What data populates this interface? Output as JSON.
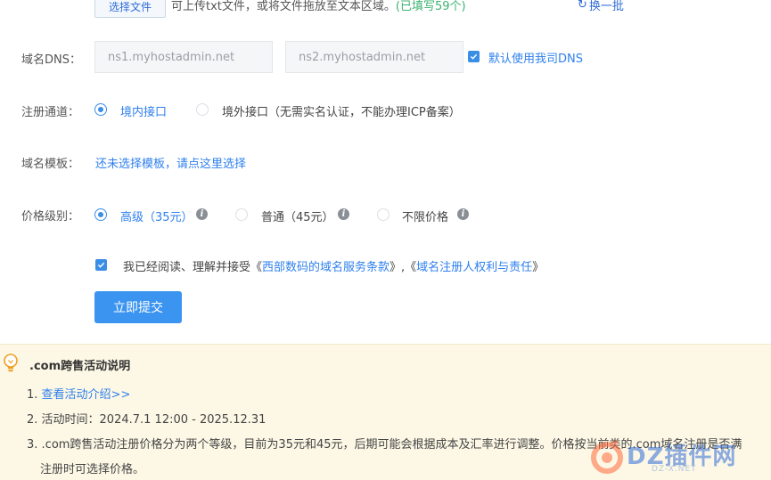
{
  "upload": {
    "button_label": "选择文件",
    "hint_prefix": "可上传txt文件，或将文件拖放至文本区域。",
    "hint_count": "(已填写59个)",
    "refresh_label": "换一批"
  },
  "dns": {
    "label": "域名DNS：",
    "ns1_value": "ns1.myhostadmin.net",
    "ns2_value": "ns2.myhostadmin.net",
    "default_checkbox_label": "默认使用我司DNS"
  },
  "channel": {
    "label": "注册通道：",
    "option_domestic": "境内接口",
    "option_overseas": "境外接口（无需实名认证，不能办理ICP备案）"
  },
  "template": {
    "label": "域名模板：",
    "link": "还未选择模板，请点这里选择"
  },
  "price": {
    "label": "价格级别：",
    "option_high": "高级（35元）",
    "option_normal": "普通（45元）",
    "option_unlimited": "不限价格"
  },
  "agreement": {
    "prefix": "我已经阅读、理解并接受《",
    "link1": "西部数码的域名服务条款",
    "middle": "》,《",
    "link2": "域名注册人权利与责任",
    "suffix": "》"
  },
  "submit_label": "立即提交",
  "notice": {
    "title": ".com跨售活动说明",
    "item1_num": "1. ",
    "item1_link": "查看活动介绍>>",
    "item2": "2. 活动时间：2024.7.1 12:00 - 2025.12.31",
    "item3": "3. .com跨售活动注册价格分为两个等级，目前为35元和45元，后期可能会根据成本及汇率进行调整。价格按当前类的.com域名注册是否满",
    "item3_cont": "注册时可选择价格。"
  },
  "watermark": {
    "brand": "DZ插件网",
    "domain": "DZ-X.NET"
  },
  "colors": {
    "accent": "#3a94f0",
    "link": "#2f80ed",
    "notice_bg": "#fdf8e6",
    "success": "#3cb371"
  }
}
